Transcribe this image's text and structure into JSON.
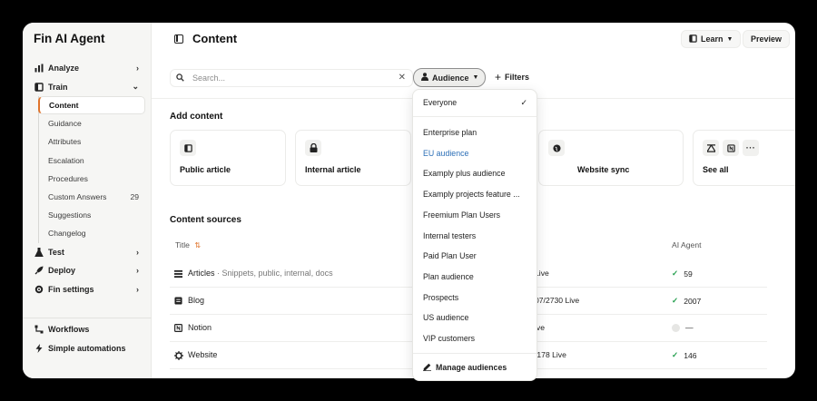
{
  "app": {
    "title": "Fin AI Agent"
  },
  "sidebar": {
    "items": [
      {
        "label": "Analyze",
        "icon": "bar-chart-icon"
      },
      {
        "label": "Train",
        "icon": "book-icon"
      },
      {
        "label": "Test",
        "icon": "flask-icon"
      },
      {
        "label": "Deploy",
        "icon": "rocket-icon"
      },
      {
        "label": "Fin settings",
        "icon": "gear-icon"
      }
    ],
    "train_sub": [
      {
        "label": "Content"
      },
      {
        "label": "Guidance"
      },
      {
        "label": "Attributes"
      },
      {
        "label": "Escalation"
      },
      {
        "label": "Procedures"
      },
      {
        "label": "Custom Answers",
        "count": "29"
      },
      {
        "label": "Suggestions"
      },
      {
        "label": "Changelog"
      }
    ],
    "bottom": [
      {
        "label": "Workflows",
        "icon": "workflow-icon"
      },
      {
        "label": "Simple automations",
        "icon": "bolt-icon"
      }
    ]
  },
  "header": {
    "title": "Content",
    "learn_label": "Learn",
    "preview_label": "Preview"
  },
  "toolbar": {
    "search_placeholder": "Search...",
    "audience_label": "Audience",
    "filters_label": "Filters"
  },
  "add_content": {
    "title": "Add content",
    "cards": [
      {
        "label": "Public article",
        "icon": "book-icon"
      },
      {
        "label": "Internal article",
        "icon": "lock-icon"
      },
      {
        "label": "Website sync",
        "icon": "globe-icon"
      },
      {
        "label": "See all",
        "icon": "more-icon"
      }
    ]
  },
  "content_sources": {
    "title": "Content sources",
    "columns": {
      "title": "Title",
      "ai_agent": "AI Agent"
    },
    "rows": [
      {
        "title": "Articles",
        "subtitle": "· Snippets, public, internal, docs",
        "status": "Live",
        "agent": "59",
        "agent_state": "check"
      },
      {
        "title": "Blog",
        "subtitle": "",
        "status": "07/2730 Live",
        "agent": "2007",
        "agent_state": "check"
      },
      {
        "title": "Notion",
        "subtitle": "",
        "status": "ive",
        "agent": "—",
        "agent_state": "dot"
      },
      {
        "title": "Website",
        "subtitle": "",
        "status": "/178 Live",
        "agent": "146",
        "agent_state": "check"
      }
    ]
  },
  "audience_menu": {
    "everyone": "Everyone",
    "items": [
      "Enterprise plan",
      "EU audience",
      "Examply plus audience",
      "Examply projects feature ...",
      "Freemium Plan Users",
      "Internal testers",
      "Paid Plan User",
      "Plan audience",
      "Prospects",
      "US audience",
      "VIP customers"
    ],
    "selected_index": 1,
    "manage_label": "Manage audiences"
  },
  "colors": {
    "accent": "#e0732a",
    "link": "#2c6fb7",
    "check": "#1f9d4a"
  }
}
